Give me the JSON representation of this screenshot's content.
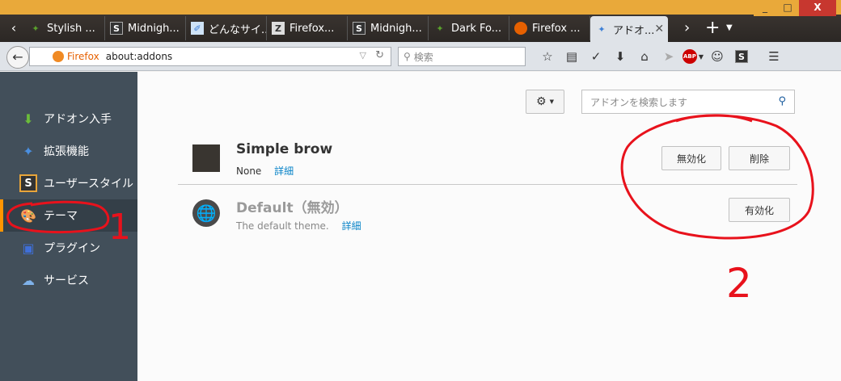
{
  "window": {
    "controls": [
      "_",
      "□",
      "X"
    ]
  },
  "tabs": [
    {
      "label": "Stylish ...",
      "icon": "puzzle-icon",
      "color": "#5aa02c"
    },
    {
      "label": "Midnigh...",
      "icon": "stylish-s-icon",
      "color": "#333333"
    },
    {
      "label": "どんなサイ...",
      "icon": "quill-icon",
      "color": "#3a7bd5"
    },
    {
      "label": "Firefox...",
      "icon": "z-icon",
      "color": "#777777"
    },
    {
      "label": "Midnigh...",
      "icon": "stylish-s-icon",
      "color": "#333333"
    },
    {
      "label": "Dark Fo...",
      "icon": "puzzle-icon",
      "color": "#5aa02c"
    },
    {
      "label": "Firefox ...",
      "icon": "firefox-icon",
      "color": "#e66000"
    },
    {
      "label": "アドオ...",
      "icon": "puzzle-blue-icon",
      "color": "#3d7fd6",
      "active": true
    }
  ],
  "navbar": {
    "identity_label": "Firefox",
    "url": "about:addons",
    "search_placeholder": "検索"
  },
  "sidebar": {
    "items": [
      {
        "label": "アドオン入手",
        "icon": "get-addons-icon"
      },
      {
        "label": "拡張機能",
        "icon": "extensions-icon"
      },
      {
        "label": "ユーザースタイル",
        "icon": "userstyles-icon"
      },
      {
        "label": "テーマ",
        "icon": "themes-icon",
        "selected": true
      },
      {
        "label": "プラグイン",
        "icon": "plugins-icon"
      },
      {
        "label": "サービス",
        "icon": "services-icon"
      }
    ]
  },
  "main": {
    "search_placeholder": "アドオンを検索します",
    "addons": [
      {
        "name": "Simple brow",
        "description": "None",
        "more_link": "詳細",
        "buttons": [
          "無効化",
          "削除"
        ],
        "enabled": true
      },
      {
        "name": "Default（無効）",
        "description": "The default theme.",
        "more_link": "詳細",
        "buttons": [
          "有効化"
        ],
        "enabled": false
      }
    ]
  },
  "annotations": {
    "label_1": "1",
    "label_2": "2",
    "color": "#e8121c"
  }
}
